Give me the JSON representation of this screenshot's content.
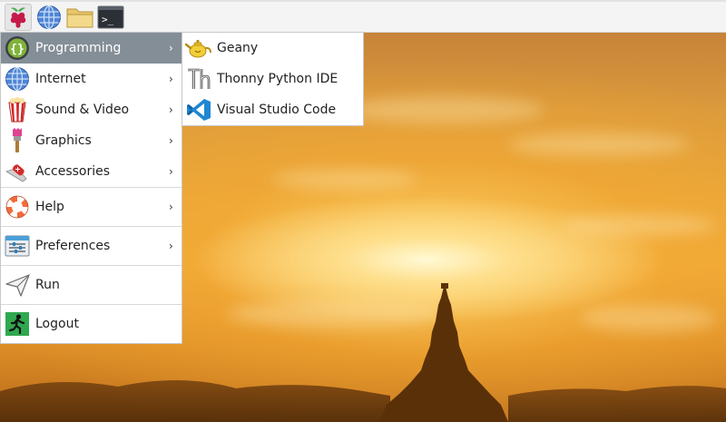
{
  "panel": {
    "icons": [
      "raspberry-menu-icon",
      "web-browser-icon",
      "file-manager-icon",
      "terminal-icon"
    ],
    "terminal_glyph": ">_"
  },
  "main_menu": {
    "items": [
      {
        "label": "Programming",
        "icon": "programming-icon",
        "active": true
      },
      {
        "label": "Internet",
        "icon": "internet-globe-icon"
      },
      {
        "label": "Sound & Video",
        "icon": "sound-video-icon"
      },
      {
        "label": "Graphics",
        "icon": "graphics-brush-icon"
      },
      {
        "label": "Accessories",
        "icon": "accessories-knife-icon"
      },
      {
        "label": "Help",
        "icon": "help-lifebuoy-icon"
      },
      {
        "label": "Preferences",
        "icon": "preferences-icon"
      },
      {
        "label": "Run",
        "icon": "run-paperplane-icon"
      },
      {
        "label": "Logout",
        "icon": "logout-exit-icon"
      }
    ],
    "submenu_arrow": "›"
  },
  "programming_submenu": {
    "items": [
      {
        "label": "Geany",
        "icon": "geany-teapot-icon"
      },
      {
        "label": "Thonny Python IDE",
        "icon": "thonny-icon"
      },
      {
        "label": "Visual Studio Code",
        "icon": "vscode-icon"
      }
    ]
  },
  "colors": {
    "active_item_bg": "#848e97",
    "menu_bg": "#ffffff",
    "panel_bg": "#f4f4f4",
    "vscode_blue": "#1f86d3"
  }
}
